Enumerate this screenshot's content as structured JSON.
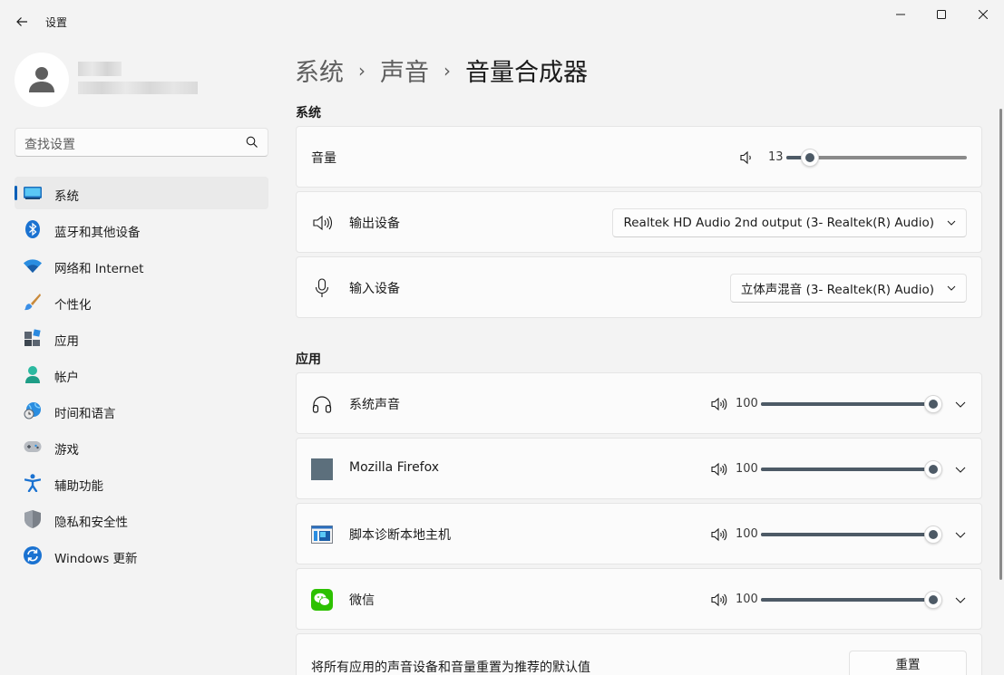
{
  "window": {
    "title": "设置",
    "accent": "#005fb8"
  },
  "search": {
    "placeholder": "查找设置"
  },
  "sidebar": {
    "items": [
      {
        "label": "系统",
        "icon": "monitor-icon",
        "active": true
      },
      {
        "label": "蓝牙和其他设备",
        "icon": "bluetooth-icon"
      },
      {
        "label": "网络和 Internet",
        "icon": "wifi-icon"
      },
      {
        "label": "个性化",
        "icon": "brush-icon"
      },
      {
        "label": "应用",
        "icon": "apps-icon"
      },
      {
        "label": "帐户",
        "icon": "account-icon"
      },
      {
        "label": "时间和语言",
        "icon": "globe-clock-icon"
      },
      {
        "label": "游戏",
        "icon": "gamepad-icon"
      },
      {
        "label": "辅助功能",
        "icon": "accessibility-icon"
      },
      {
        "label": "隐私和安全性",
        "icon": "shield-icon"
      },
      {
        "label": "Windows 更新",
        "icon": "update-icon"
      }
    ]
  },
  "breadcrumb": {
    "items": [
      "系统",
      "声音"
    ],
    "current": "音量合成器"
  },
  "system_section": {
    "title": "系统",
    "volume": {
      "label": "音量",
      "value": "13",
      "level": 13
    },
    "output": {
      "label": "输出设备",
      "selected": "Realtek HD Audio 2nd output (3- Realtek(R) Audio)"
    },
    "input": {
      "label": "输入设备",
      "selected": "立体声混音 (3- Realtek(R) Audio)"
    }
  },
  "apps_section": {
    "title": "应用",
    "apps": [
      {
        "name": "系统声音",
        "icon": "headphones-icon",
        "volume": "100",
        "level": 100
      },
      {
        "name": "Mozilla Firefox",
        "icon": "firefox-placeholder-icon",
        "volume": "100",
        "level": 100
      },
      {
        "name": "脚本诊断本地主机",
        "icon": "script-host-icon",
        "volume": "100",
        "level": 100
      },
      {
        "name": "微信",
        "icon": "wechat-icon",
        "volume": "100",
        "level": 100
      }
    ],
    "reset_text": "将所有应用的声音设备和音量重置为推荐的默认值",
    "reset_button": "重置"
  }
}
